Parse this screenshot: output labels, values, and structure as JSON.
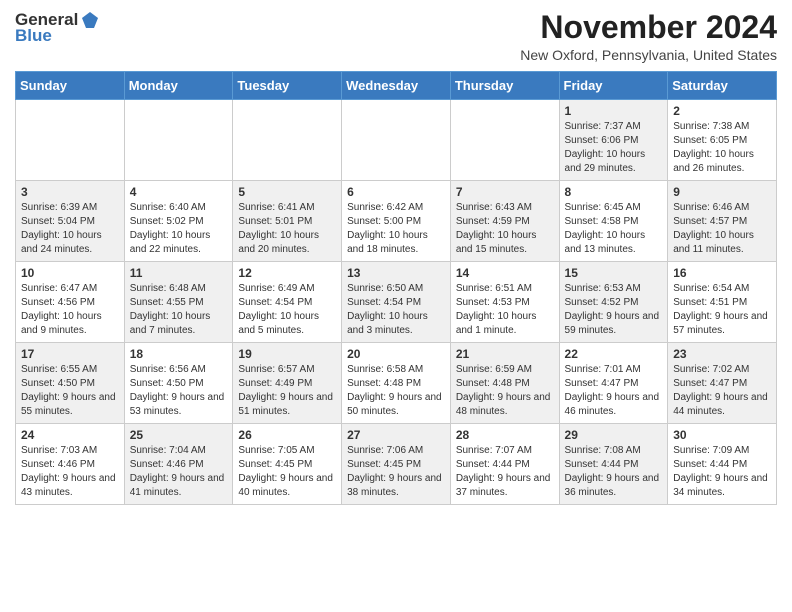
{
  "logo": {
    "general": "General",
    "blue": "Blue"
  },
  "title": "November 2024",
  "location": "New Oxford, Pennsylvania, United States",
  "days_of_week": [
    "Sunday",
    "Monday",
    "Tuesday",
    "Wednesday",
    "Thursday",
    "Friday",
    "Saturday"
  ],
  "weeks": [
    [
      {
        "day": "",
        "info": ""
      },
      {
        "day": "",
        "info": ""
      },
      {
        "day": "",
        "info": ""
      },
      {
        "day": "",
        "info": ""
      },
      {
        "day": "",
        "info": ""
      },
      {
        "day": "1",
        "info": "Sunrise: 7:37 AM\nSunset: 6:06 PM\nDaylight: 10 hours and 29 minutes."
      },
      {
        "day": "2",
        "info": "Sunrise: 7:38 AM\nSunset: 6:05 PM\nDaylight: 10 hours and 26 minutes."
      }
    ],
    [
      {
        "day": "3",
        "info": "Sunrise: 6:39 AM\nSunset: 5:04 PM\nDaylight: 10 hours and 24 minutes."
      },
      {
        "day": "4",
        "info": "Sunrise: 6:40 AM\nSunset: 5:02 PM\nDaylight: 10 hours and 22 minutes."
      },
      {
        "day": "5",
        "info": "Sunrise: 6:41 AM\nSunset: 5:01 PM\nDaylight: 10 hours and 20 minutes."
      },
      {
        "day": "6",
        "info": "Sunrise: 6:42 AM\nSunset: 5:00 PM\nDaylight: 10 hours and 18 minutes."
      },
      {
        "day": "7",
        "info": "Sunrise: 6:43 AM\nSunset: 4:59 PM\nDaylight: 10 hours and 15 minutes."
      },
      {
        "day": "8",
        "info": "Sunrise: 6:45 AM\nSunset: 4:58 PM\nDaylight: 10 hours and 13 minutes."
      },
      {
        "day": "9",
        "info": "Sunrise: 6:46 AM\nSunset: 4:57 PM\nDaylight: 10 hours and 11 minutes."
      }
    ],
    [
      {
        "day": "10",
        "info": "Sunrise: 6:47 AM\nSunset: 4:56 PM\nDaylight: 10 hours and 9 minutes."
      },
      {
        "day": "11",
        "info": "Sunrise: 6:48 AM\nSunset: 4:55 PM\nDaylight: 10 hours and 7 minutes."
      },
      {
        "day": "12",
        "info": "Sunrise: 6:49 AM\nSunset: 4:54 PM\nDaylight: 10 hours and 5 minutes."
      },
      {
        "day": "13",
        "info": "Sunrise: 6:50 AM\nSunset: 4:54 PM\nDaylight: 10 hours and 3 minutes."
      },
      {
        "day": "14",
        "info": "Sunrise: 6:51 AM\nSunset: 4:53 PM\nDaylight: 10 hours and 1 minute."
      },
      {
        "day": "15",
        "info": "Sunrise: 6:53 AM\nSunset: 4:52 PM\nDaylight: 9 hours and 59 minutes."
      },
      {
        "day": "16",
        "info": "Sunrise: 6:54 AM\nSunset: 4:51 PM\nDaylight: 9 hours and 57 minutes."
      }
    ],
    [
      {
        "day": "17",
        "info": "Sunrise: 6:55 AM\nSunset: 4:50 PM\nDaylight: 9 hours and 55 minutes."
      },
      {
        "day": "18",
        "info": "Sunrise: 6:56 AM\nSunset: 4:50 PM\nDaylight: 9 hours and 53 minutes."
      },
      {
        "day": "19",
        "info": "Sunrise: 6:57 AM\nSunset: 4:49 PM\nDaylight: 9 hours and 51 minutes."
      },
      {
        "day": "20",
        "info": "Sunrise: 6:58 AM\nSunset: 4:48 PM\nDaylight: 9 hours and 50 minutes."
      },
      {
        "day": "21",
        "info": "Sunrise: 6:59 AM\nSunset: 4:48 PM\nDaylight: 9 hours and 48 minutes."
      },
      {
        "day": "22",
        "info": "Sunrise: 7:01 AM\nSunset: 4:47 PM\nDaylight: 9 hours and 46 minutes."
      },
      {
        "day": "23",
        "info": "Sunrise: 7:02 AM\nSunset: 4:47 PM\nDaylight: 9 hours and 44 minutes."
      }
    ],
    [
      {
        "day": "24",
        "info": "Sunrise: 7:03 AM\nSunset: 4:46 PM\nDaylight: 9 hours and 43 minutes."
      },
      {
        "day": "25",
        "info": "Sunrise: 7:04 AM\nSunset: 4:46 PM\nDaylight: 9 hours and 41 minutes."
      },
      {
        "day": "26",
        "info": "Sunrise: 7:05 AM\nSunset: 4:45 PM\nDaylight: 9 hours and 40 minutes."
      },
      {
        "day": "27",
        "info": "Sunrise: 7:06 AM\nSunset: 4:45 PM\nDaylight: 9 hours and 38 minutes."
      },
      {
        "day": "28",
        "info": "Sunrise: 7:07 AM\nSunset: 4:44 PM\nDaylight: 9 hours and 37 minutes."
      },
      {
        "day": "29",
        "info": "Sunrise: 7:08 AM\nSunset: 4:44 PM\nDaylight: 9 hours and 36 minutes."
      },
      {
        "day": "30",
        "info": "Sunrise: 7:09 AM\nSunset: 4:44 PM\nDaylight: 9 hours and 34 minutes."
      }
    ]
  ]
}
